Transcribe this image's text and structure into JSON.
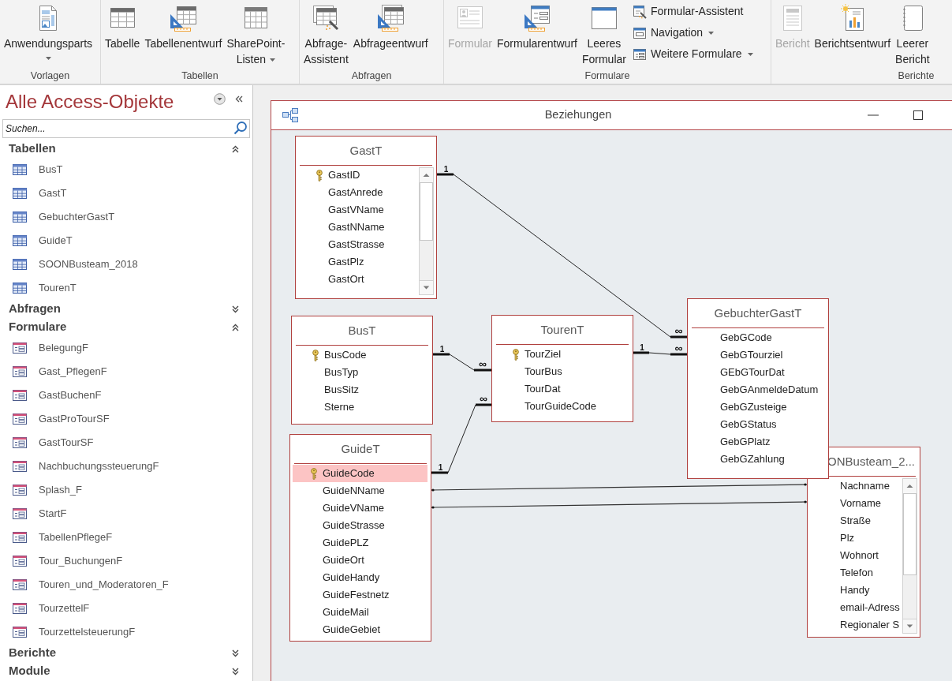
{
  "ribbon": {
    "groups": [
      {
        "label": "Vorlagen",
        "buttons": [
          {
            "kind": "app_parts",
            "label": "Anwendungsparts",
            "dropdown": true,
            "disabled": false
          }
        ]
      },
      {
        "label": "Tabellen",
        "buttons": [
          {
            "kind": "table",
            "label": "Tabelle",
            "dropdown": false,
            "disabled": false
          },
          {
            "kind": "table_design",
            "label": "Tabellenentwurf",
            "dropdown": false,
            "disabled": false
          },
          {
            "kind": "list",
            "label": "SharePoint-\nListen",
            "dropdown": true,
            "disabled": false
          }
        ]
      },
      {
        "label": "Abfragen",
        "buttons": [
          {
            "kind": "query_wizard",
            "label": "Abfrage-\nAssistent",
            "dropdown": false,
            "disabled": false
          },
          {
            "kind": "query_design",
            "label": "Abfrageentwurf",
            "dropdown": false,
            "disabled": false
          }
        ]
      },
      {
        "label": "Formulare",
        "buttons": [
          {
            "kind": "form",
            "label": "Formular",
            "dropdown": false,
            "disabled": true
          },
          {
            "kind": "form_design",
            "label": "Formularentwurf",
            "dropdown": false,
            "disabled": false
          },
          {
            "kind": "blank_form",
            "label": "Leeres\nFormular",
            "dropdown": false,
            "disabled": false
          }
        ],
        "small_buttons": [
          {
            "kind": "form_wizard",
            "label": "Formular-Assistent",
            "dropdown": false,
            "disabled": false
          },
          {
            "kind": "navigation",
            "label": "Navigation",
            "dropdown": true,
            "disabled": false
          },
          {
            "kind": "more_forms",
            "label": "Weitere Formulare",
            "dropdown": true,
            "disabled": false
          }
        ]
      },
      {
        "label": "Berichte",
        "buttons": [
          {
            "kind": "report",
            "label": "Bericht",
            "dropdown": false,
            "disabled": true
          },
          {
            "kind": "report_design",
            "label": "Berichtsentwurf",
            "dropdown": false,
            "disabled": false
          },
          {
            "kind": "blank_report",
            "label": "Leerer\nBericht",
            "dropdown": false,
            "disabled": false
          }
        ]
      }
    ]
  },
  "navigation_pane": {
    "title": "Alle Access-Objekte",
    "search": {
      "placeholder": "Suchen..."
    },
    "groups": [
      {
        "label": "Tabellen",
        "expanded": true,
        "items": [
          {
            "kind": "table",
            "label": "BusT",
            "selected": false
          },
          {
            "kind": "table",
            "label": "GastT",
            "selected": false
          },
          {
            "kind": "table",
            "label": "GebuchterGastT",
            "selected": false
          },
          {
            "kind": "table",
            "label": "GuideT",
            "selected": false
          },
          {
            "kind": "table",
            "label": "SOONBusteam_2018",
            "selected": false
          },
          {
            "kind": "table",
            "label": "TourenT",
            "selected": false
          }
        ]
      },
      {
        "label": "Abfragen",
        "expanded": false
      },
      {
        "label": "Formulare",
        "expanded": true,
        "items": [
          {
            "kind": "form",
            "label": "BelegungF",
            "selected": false
          },
          {
            "kind": "form",
            "label": "Gast_PflegenF",
            "selected": false
          },
          {
            "kind": "form",
            "label": "GastBuchenF",
            "selected": false
          },
          {
            "kind": "form",
            "label": "GastProTourSF",
            "selected": false
          },
          {
            "kind": "form",
            "label": "GastTourSF",
            "selected": false
          },
          {
            "kind": "form",
            "label": "NachbuchungssteuerungF",
            "selected": false
          },
          {
            "kind": "form",
            "label": "Splash_F",
            "selected": false
          },
          {
            "kind": "form",
            "label": "StartF",
            "selected": false
          },
          {
            "kind": "form",
            "label": "TabellenPflegeF",
            "selected": false
          },
          {
            "kind": "form",
            "label": "Tour_BuchungenF",
            "selected": false
          },
          {
            "kind": "form",
            "label": "Touren_und_Moderatoren_F",
            "selected": false
          },
          {
            "kind": "form",
            "label": "TourzettelF",
            "selected": false
          },
          {
            "kind": "form",
            "label": "TourzettelsteuerungF",
            "selected": false
          }
        ]
      },
      {
        "label": "Berichte",
        "expanded": false
      },
      {
        "label": "Module",
        "expanded": false
      }
    ]
  },
  "relationships_window": {
    "title": "Beziehungen",
    "tables": [
      {
        "title": "GastT",
        "scrollbar": true,
        "fields": [
          {
            "name": "GastID",
            "key": true,
            "selected": false
          },
          {
            "name": "GastAnrede",
            "key": false,
            "selected": false
          },
          {
            "name": "GastVName",
            "key": false,
            "selected": false
          },
          {
            "name": "GastNName",
            "key": false,
            "selected": false
          },
          {
            "name": "GastStrasse",
            "key": false,
            "selected": false
          },
          {
            "name": "GastPlz",
            "key": false,
            "selected": false
          },
          {
            "name": "GastOrt",
            "key": false,
            "selected": false
          }
        ]
      },
      {
        "title": "BusT",
        "scrollbar": false,
        "fields": [
          {
            "name": "BusCode",
            "key": true,
            "selected": false
          },
          {
            "name": "BusTyp",
            "key": false,
            "selected": false
          },
          {
            "name": "BusSitz",
            "key": false,
            "selected": false
          },
          {
            "name": "Sterne",
            "key": false,
            "selected": false
          }
        ]
      },
      {
        "title": "TourenT",
        "scrollbar": false,
        "fields": [
          {
            "name": "TourZiel",
            "key": true,
            "selected": false
          },
          {
            "name": "TourBus",
            "key": false,
            "selected": false
          },
          {
            "name": "TourDat",
            "key": false,
            "selected": false
          },
          {
            "name": "TourGuideCode",
            "key": false,
            "selected": false
          }
        ]
      },
      {
        "title": "GebuchterGastT",
        "scrollbar": false,
        "fields": [
          {
            "name": "GebGCode",
            "key": false,
            "selected": false
          },
          {
            "name": "GebGTourziel",
            "key": false,
            "selected": false
          },
          {
            "name": "GEbGTourDat",
            "key": false,
            "selected": false
          },
          {
            "name": "GebGAnmeldeDatum",
            "key": false,
            "selected": false
          },
          {
            "name": "GebGZusteige",
            "key": false,
            "selected": false
          },
          {
            "name": "GebGStatus",
            "key": false,
            "selected": false
          },
          {
            "name": "GebGPlatz",
            "key": false,
            "selected": false
          },
          {
            "name": "GebGZahlung",
            "key": false,
            "selected": false
          }
        ]
      },
      {
        "title": "GuideT",
        "scrollbar": false,
        "fields": [
          {
            "name": "GuideCode",
            "key": true,
            "selected": true
          },
          {
            "name": "GuideNName",
            "key": false,
            "selected": false
          },
          {
            "name": "GuideVName",
            "key": false,
            "selected": false
          },
          {
            "name": "GuideStrasse",
            "key": false,
            "selected": false
          },
          {
            "name": "GuidePLZ",
            "key": false,
            "selected": false
          },
          {
            "name": "GuideOrt",
            "key": false,
            "selected": false
          },
          {
            "name": "GuideHandy",
            "key": false,
            "selected": false
          },
          {
            "name": "GuideFestnetz",
            "key": false,
            "selected": false
          },
          {
            "name": "GuideMail",
            "key": false,
            "selected": false
          },
          {
            "name": "GuideGebiet",
            "key": false,
            "selected": false
          }
        ]
      },
      {
        "title": "ONBusteam_2...",
        "scrollbar": true,
        "fields": [
          {
            "name": "Nachname",
            "key": false,
            "selected": false
          },
          {
            "name": "Vorname",
            "key": false,
            "selected": false
          },
          {
            "name": "Straße",
            "key": false,
            "selected": false
          },
          {
            "name": "Plz",
            "key": false,
            "selected": false
          },
          {
            "name": "Wohnort",
            "key": false,
            "selected": false
          },
          {
            "name": "Telefon",
            "key": false,
            "selected": false
          },
          {
            "name": "Handy",
            "key": false,
            "selected": false
          },
          {
            "name": "email-Adress",
            "key": false,
            "selected": false
          },
          {
            "name": "Regionaler S",
            "key": false,
            "selected": false
          }
        ]
      }
    ],
    "relationships": [
      {
        "kind": "one_to_many",
        "one_label": "1",
        "many_label": "∞"
      },
      {
        "kind": "one_to_many",
        "one_label": "1",
        "many_label": "∞"
      },
      {
        "kind": "one_to_many",
        "one_label": "1",
        "many_label": "∞"
      },
      {
        "kind": "one_to_many",
        "one_label": "1",
        "many_label": "∞"
      },
      {
        "kind": "join"
      },
      {
        "kind": "join"
      }
    ]
  }
}
